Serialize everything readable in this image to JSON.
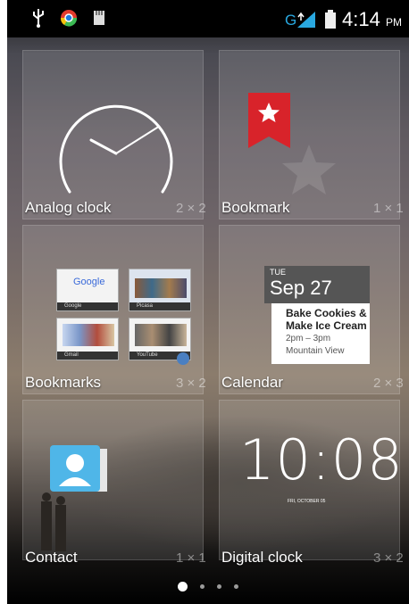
{
  "status_bar": {
    "time": "4:14",
    "ampm": "PM",
    "network": "G"
  },
  "widgets": [
    {
      "label": "Analog clock",
      "size": "2 × 2"
    },
    {
      "label": "Bookmark",
      "size": "1 × 1"
    },
    {
      "label": "Bookmarks",
      "size": "3 × 2"
    },
    {
      "label": "Calendar",
      "size": "2 × 3"
    },
    {
      "label": "Contact",
      "size": "1 × 1"
    },
    {
      "label": "Digital clock",
      "size": "3 × 2"
    }
  ],
  "bookmark_thumbs": [
    "Google",
    "Picasa",
    "Gmail",
    "YouTube"
  ],
  "thumb_google_logo": "Google",
  "calendar": {
    "weekday": "TUE",
    "date": "Sep 27",
    "event_title_1": "Bake Cookies &",
    "event_title_2": "Make Ice Cream",
    "event_time": "2pm – 3pm",
    "event_location": "Mountain View"
  },
  "digital_clock": {
    "time": "10:08",
    "date": "FRI, OCTOBER 05"
  },
  "page_indicator": {
    "pages": 4,
    "current": 1
  },
  "colors": {
    "bookmark_red": "#d8232a",
    "status_icon_blue": "#29a8e0"
  }
}
